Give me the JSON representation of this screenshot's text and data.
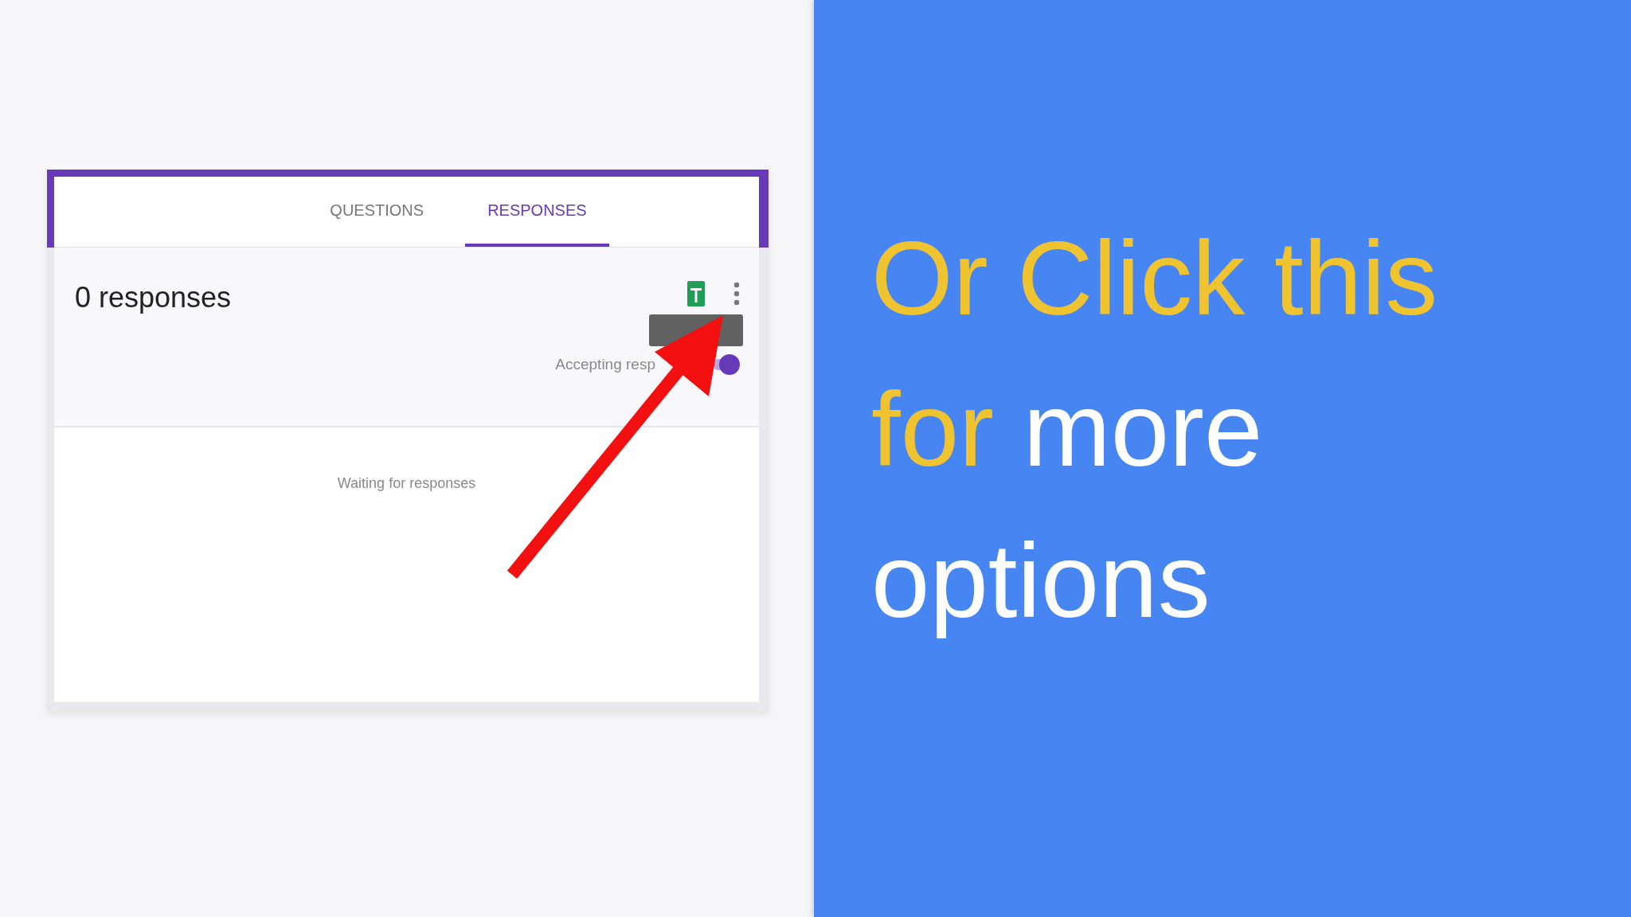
{
  "form": {
    "tabs": [
      {
        "label": "QUESTIONS",
        "selected": false
      },
      {
        "label": "RESPONSES",
        "selected": true
      }
    ],
    "count": "0 responses",
    "toggle_label": "Accepting resp",
    "accepting": true,
    "empty_message": "Waiting for responses"
  },
  "caption": {
    "lines": [
      [
        {
          "text": "Or Click this",
          "highlight": true
        }
      ],
      [
        {
          "text": "for",
          "highlight": true
        },
        {
          "text": " more",
          "highlight": false
        }
      ],
      [
        {
          "text": "options",
          "highlight": false
        }
      ]
    ]
  }
}
